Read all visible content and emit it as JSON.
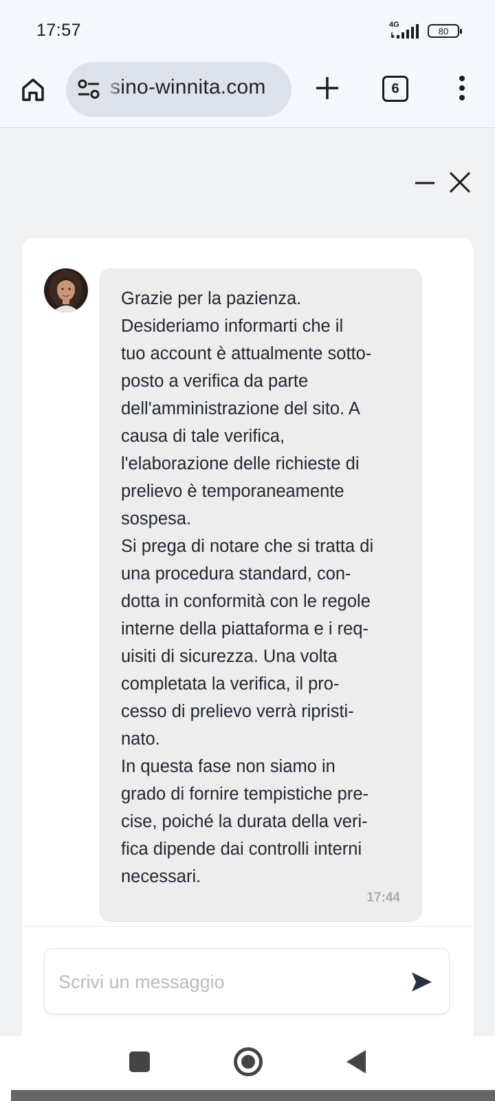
{
  "status_bar": {
    "time": "17:57",
    "network": "4G",
    "battery": "80"
  },
  "browser": {
    "url": "sino-winnita.com",
    "tab_count": "6",
    "icons": [
      "home-icon",
      "tune-icon",
      "plus-icon",
      "tabs-icon",
      "more-vert-icon"
    ]
  },
  "chat": {
    "controls": [
      "minimize-icon",
      "close-icon"
    ],
    "message": {
      "text": "Grazie per la pazienza.\nDesideriamo informarti che il\ntuo account è attualmente sotto-\nposto a verifica da parte\ndell'amministrazione del sito. A\ncausa di tale verifica,\nl'elaborazione delle richieste di\nprelievo è temporaneamente\nsospesa.\nSi prega di notare che si tratta di\nuna procedura standard, con-\ndotta in conformità con le regole\ninterne della piattaforma e i req-\nuisiti di sicurezza. Una volta\ncompletata la verifica, il pro-\ncesso di prelievo verrà ripristi-\nnato.\nIn questa fase non siamo in\ngrado di fornire tempistiche pre-\ncise, poiché la durata della veri-\nfica dipende dai controlli interni\nnecessari.",
      "time": "17:44"
    },
    "input": {
      "placeholder": "Scrivi un messaggio",
      "value": ""
    }
  },
  "nav": {
    "icons": [
      "recents-icon",
      "home-circle-icon",
      "back-icon"
    ]
  },
  "colors": {
    "bubble_bg": "#ededed",
    "page_bg": "#f1f2f4",
    "send_icon": "#2a3142"
  }
}
